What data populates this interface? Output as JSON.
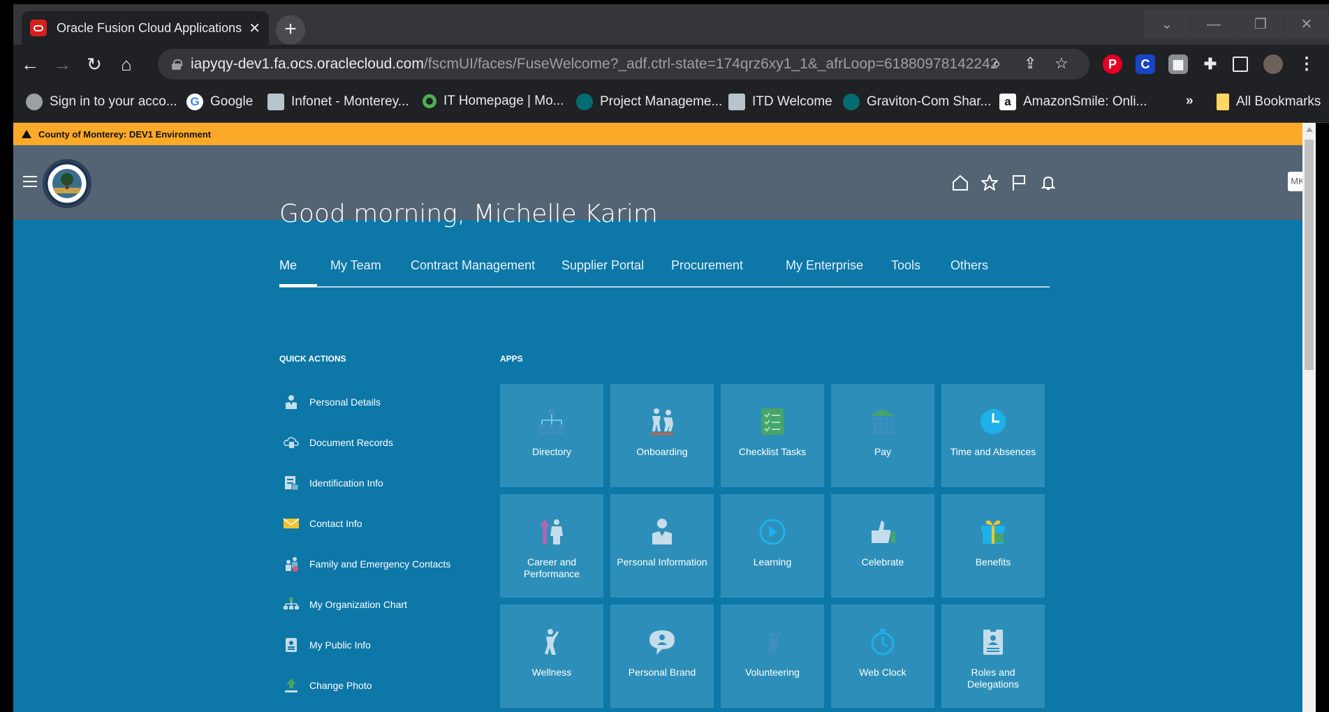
{
  "browser": {
    "tab_title": "Oracle Fusion Cloud Applications",
    "url_host": "iapyqy-dev1.fa.ocs.oraclecloud.com",
    "url_path": "/fscmUI/faces/FuseWelcome?_adf.ctrl-state=174qrz6xy1_1&_afrLoop=61880978142242...",
    "bookmarks": [
      {
        "label": "Sign in to your acco...",
        "icon": "globe-icon",
        "color": "#9aa0a6"
      },
      {
        "label": "Google",
        "icon": "google-icon",
        "color": "#ffffff"
      },
      {
        "label": "Infonet - Monterey...",
        "icon": "county-seal-icon",
        "color": "#b8c4cc"
      },
      {
        "label": "IT Homepage | Mo...",
        "icon": "circle-icon",
        "color": "#4caf50"
      },
      {
        "label": "Project Manageme...",
        "icon": "sharepoint-icon",
        "color": "#036c70"
      },
      {
        "label": "ITD Welcome",
        "icon": "county-seal-icon",
        "color": "#b8c4cc"
      },
      {
        "label": "Graviton-Com Shar...",
        "icon": "sharepoint-icon",
        "color": "#036c70"
      },
      {
        "label": "AmazonSmile: Onli...",
        "icon": "amazon-icon",
        "color": "#ffffff"
      }
    ],
    "more_bookmarks": "»",
    "all_bookmarks": "All Bookmarks"
  },
  "banner": {
    "text": "County of Monterey: DEV1 Environment"
  },
  "header": {
    "avatar_initials": "MK"
  },
  "greeting": "Good morning, Michelle Karim",
  "nav_tabs": [
    "Me",
    "My Team",
    "Contract Management",
    "Supplier Portal",
    "Procurement",
    "My Enterprise",
    "Tools",
    "Others"
  ],
  "quick_actions": {
    "title": "QUICK ACTIONS",
    "items": [
      {
        "label": "Personal Details",
        "icon": "person-icon"
      },
      {
        "label": "Document Records",
        "icon": "cloud-document-icon"
      },
      {
        "label": "Identification Info",
        "icon": "id-document-icon"
      },
      {
        "label": "Contact Info",
        "icon": "envelope-icon"
      },
      {
        "label": "Family and Emergency Contacts",
        "icon": "family-icon"
      },
      {
        "label": "My Organization Chart",
        "icon": "org-chart-icon"
      },
      {
        "label": "My Public Info",
        "icon": "badge-icon"
      },
      {
        "label": "Change Photo",
        "icon": "upload-icon"
      }
    ]
  },
  "apps": {
    "title": "APPS",
    "tiles": [
      {
        "label": "Directory",
        "icon": "directory-icon"
      },
      {
        "label": "Onboarding",
        "icon": "onboarding-icon"
      },
      {
        "label": "Checklist Tasks",
        "icon": "checklist-icon"
      },
      {
        "label": "Pay",
        "icon": "bank-icon"
      },
      {
        "label": "Time and Absences",
        "icon": "clock-icon"
      },
      {
        "label": "Career and Performance",
        "icon": "career-icon"
      },
      {
        "label": "Personal Information",
        "icon": "person-icon"
      },
      {
        "label": "Learning",
        "icon": "play-icon"
      },
      {
        "label": "Celebrate",
        "icon": "thumbs-up-icon"
      },
      {
        "label": "Benefits",
        "icon": "gift-icon"
      },
      {
        "label": "Wellness",
        "icon": "wellness-icon"
      },
      {
        "label": "Personal Brand",
        "icon": "speech-bubble-icon"
      },
      {
        "label": "Volunteering",
        "icon": "volunteer-icon"
      },
      {
        "label": "Web Clock",
        "icon": "stopwatch-icon"
      },
      {
        "label": "Roles and Delegations",
        "icon": "roles-icon"
      }
    ]
  }
}
